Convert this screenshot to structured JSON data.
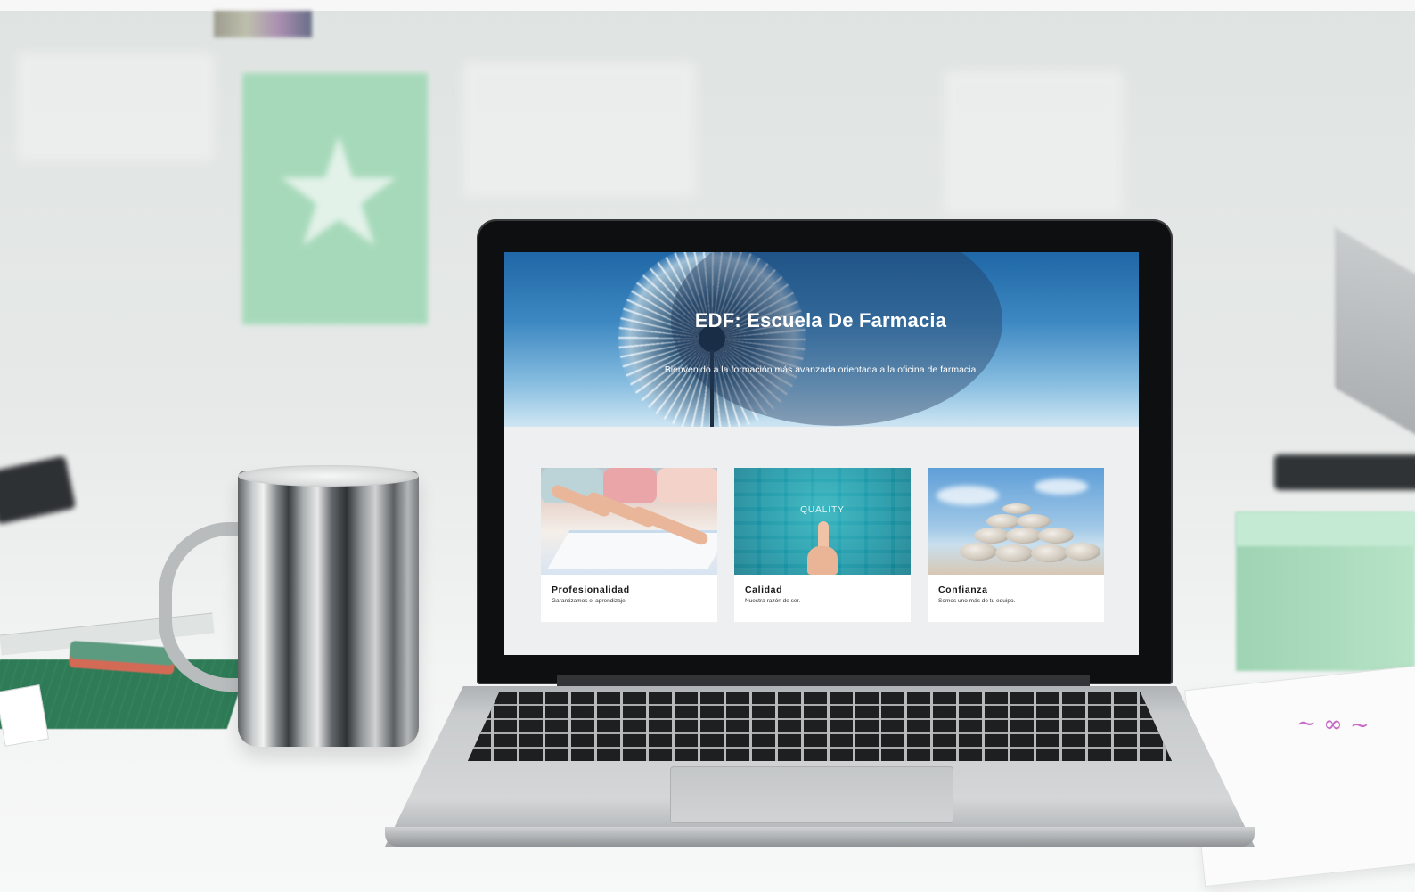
{
  "website": {
    "hero": {
      "title": "EDF: Escuela De Farmacia",
      "subtitle": "Bienvenido a la formación más avanzada orientada a la oficina de farmacia."
    },
    "cards": [
      {
        "title": "Profesionalidad",
        "description": "Garantizamos el aprendizaje.",
        "image": "students-writing"
      },
      {
        "title": "Calidad",
        "description": "Nuestra razón de ser.",
        "image": "quality-hand",
        "image_text": "QUALITY"
      },
      {
        "title": "Confianza",
        "description": "Somos uno más de tu equipo.",
        "image": "stacked-stones"
      }
    ]
  },
  "colors": {
    "hero_blue": "#1f67a6",
    "mint_accent": "#a3d9b8",
    "screen_bg": "#edeff0"
  }
}
